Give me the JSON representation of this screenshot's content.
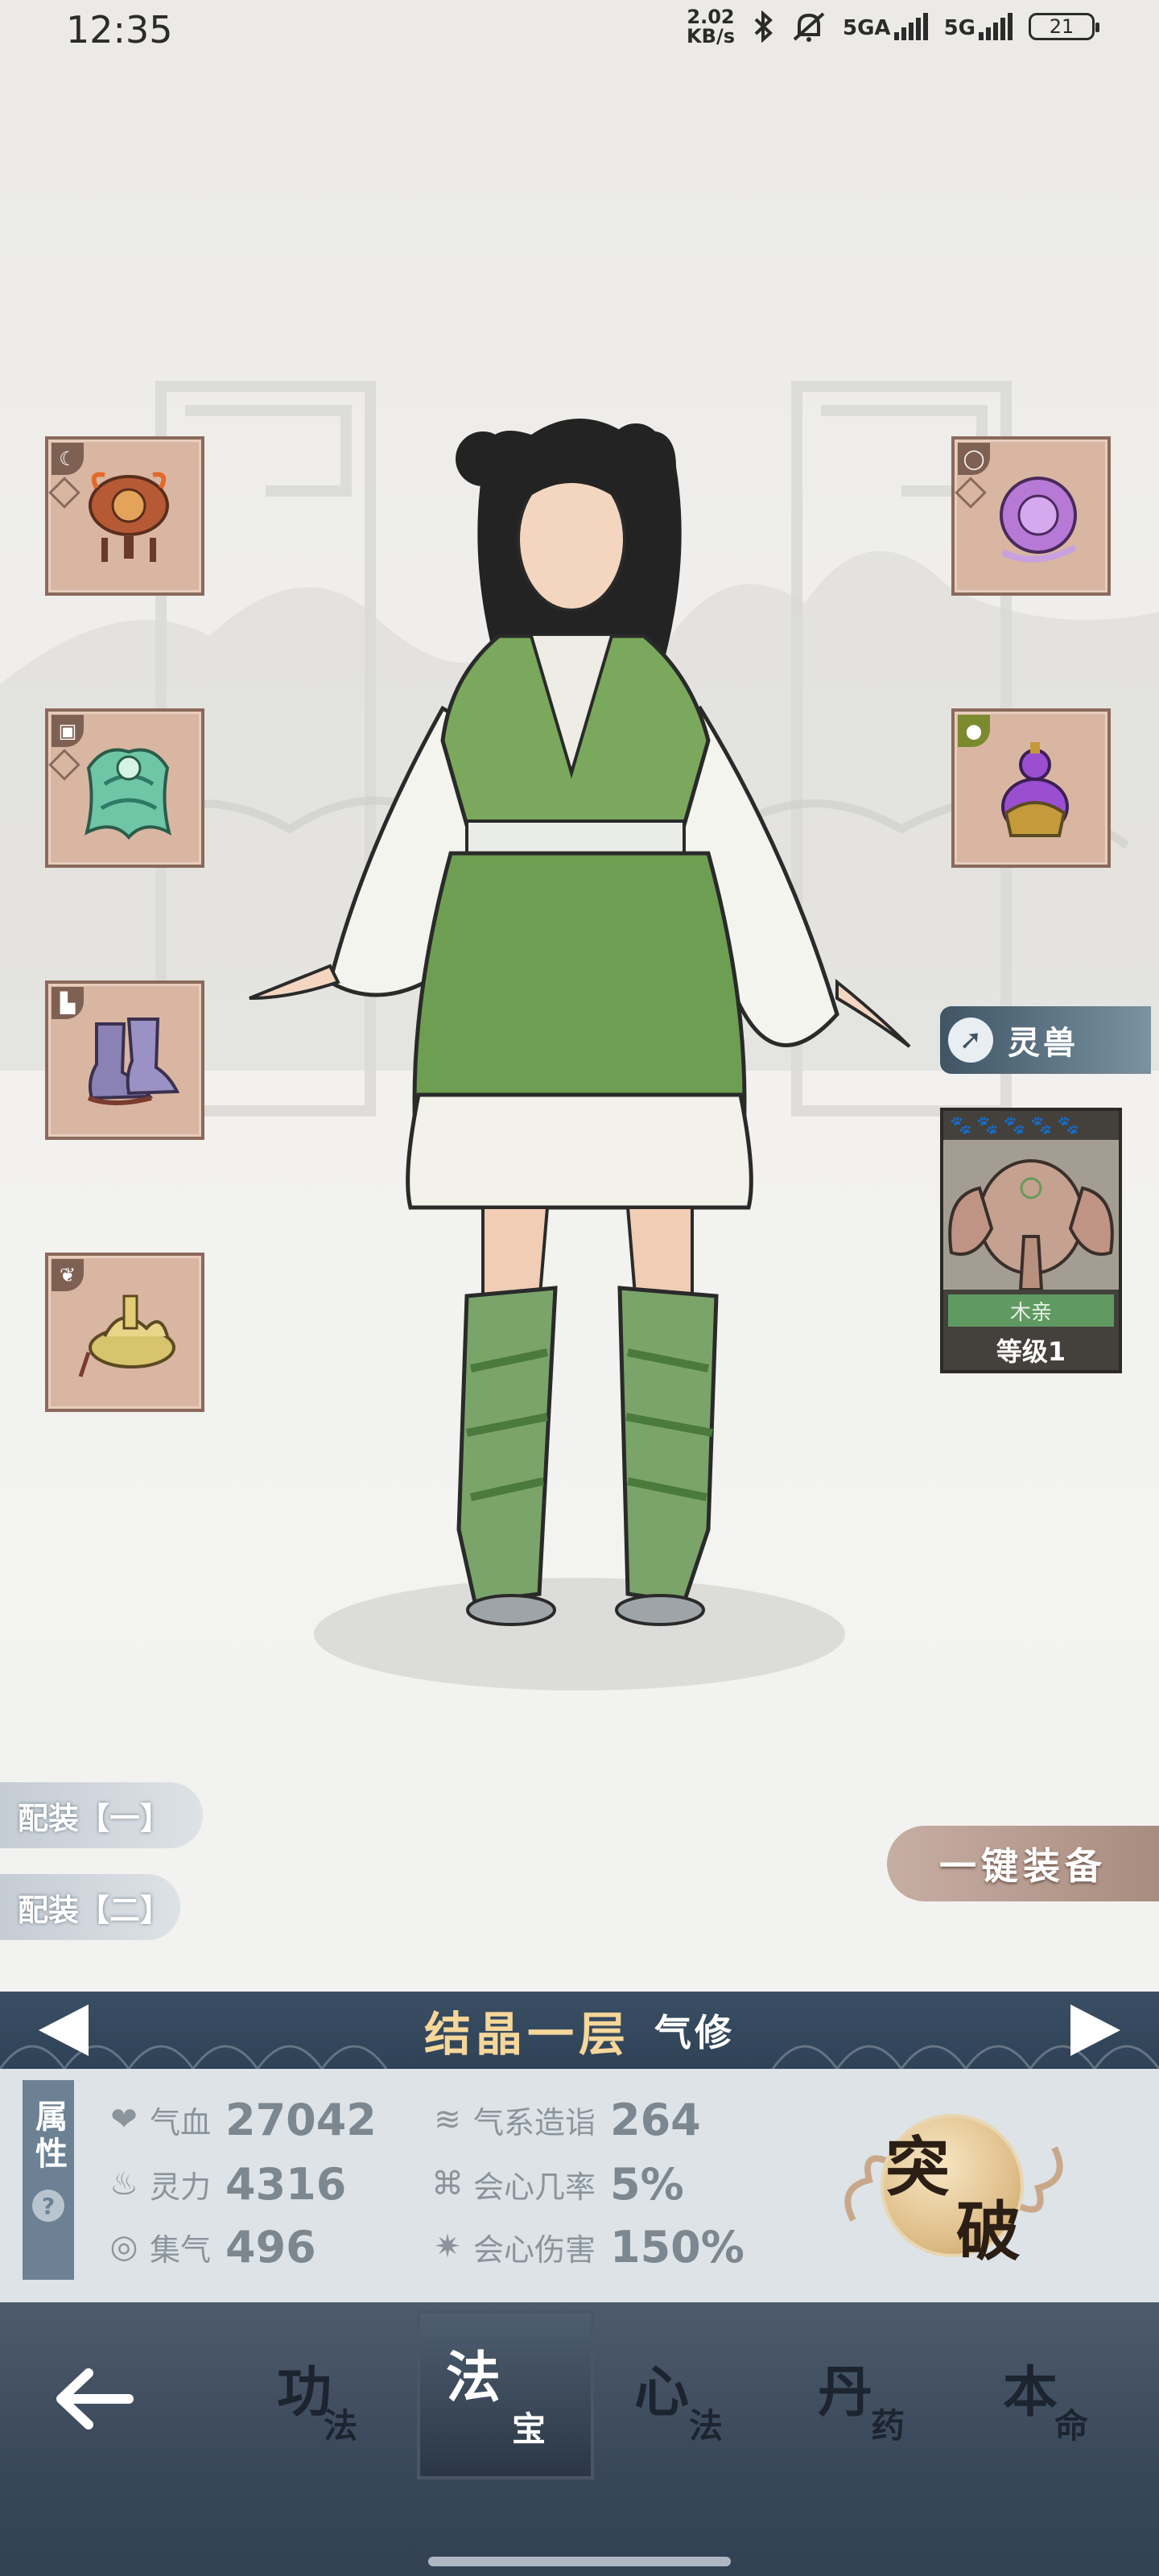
{
  "status_bar": {
    "time": "12:35",
    "speed_value": "2.02",
    "speed_unit": "KB/s",
    "network1": "5GA",
    "network2": "5G",
    "battery": "21",
    "icons": [
      "bluetooth-icon",
      "mute-icon",
      "signal-icon",
      "battery-icon"
    ]
  },
  "equipment": {
    "left_slots": [
      "weapon-slot",
      "armor-slot",
      "boots-slot",
      "accessory-slot"
    ],
    "right_slots": [
      "ring-slot",
      "gourd-slot"
    ]
  },
  "spirit_beast": {
    "tab_label": "灵兽",
    "element": "木亲",
    "level": "等级1",
    "stars_filled": 1,
    "stars_total": 5
  },
  "loadouts": {
    "loadout1": "配装【一】",
    "loadout2": "配装【二】",
    "equip_all": "一键装备"
  },
  "realm": {
    "name": "结晶一层",
    "type": "气修"
  },
  "stats_panel": {
    "tab_label": "属性",
    "help": "?",
    "stats": [
      {
        "label": "气血",
        "value": "27042",
        "icon": "heart-icon"
      },
      {
        "label": "灵力",
        "value": "4316",
        "icon": "flame-icon"
      },
      {
        "label": "集气",
        "value": "496",
        "icon": "swirl-icon"
      },
      {
        "label": "气系造诣",
        "value": "264",
        "icon": "wind-icon"
      },
      {
        "label": "会心几率",
        "value": "5%",
        "icon": "crit-rate-icon"
      },
      {
        "label": "会心伤害",
        "value": "150%",
        "icon": "crit-damage-icon"
      }
    ],
    "breakthrough_1": "突",
    "breakthrough_2": "破"
  },
  "bottom_nav": {
    "tabs": [
      {
        "big": "功",
        "small": "法"
      },
      {
        "big": "法",
        "small": "宝"
      },
      {
        "big": "心",
        "small": "法"
      },
      {
        "big": "丹",
        "small": "药"
      },
      {
        "big": "本",
        "small": "命"
      }
    ],
    "active_index": 1
  },
  "colors": {
    "nav_bg": "#3a4759",
    "realm_name": "#f6d79a",
    "slot_bg": "#d9b6a2",
    "beast_element": "#5f9a62"
  }
}
